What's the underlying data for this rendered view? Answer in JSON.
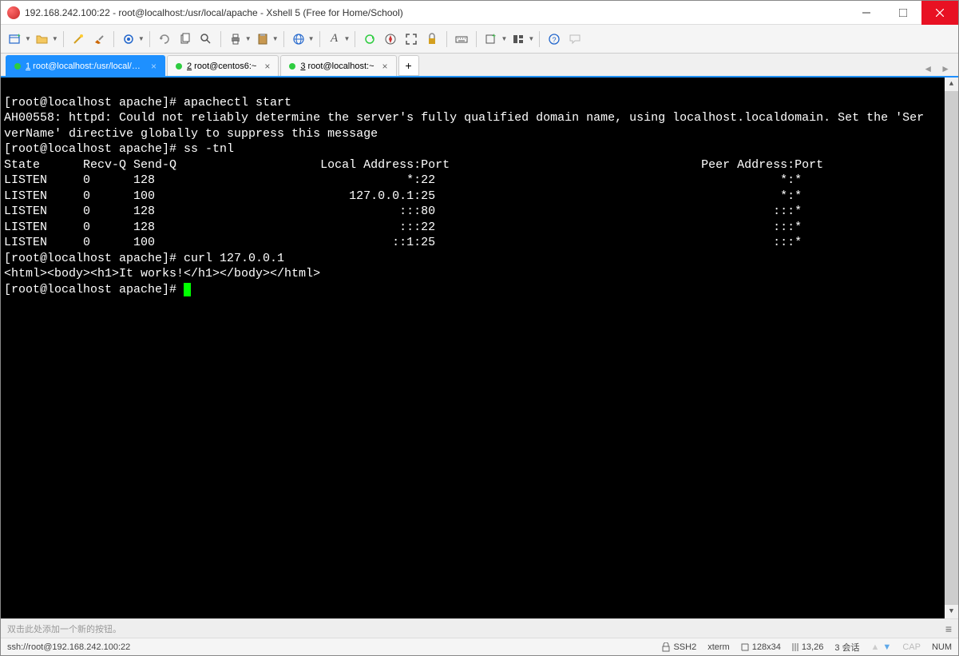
{
  "window": {
    "title": "192.168.242.100:22 - root@localhost:/usr/local/apache - Xshell 5 (Free for Home/School)"
  },
  "toolbar": {
    "icons": [
      "new-window",
      "open",
      "",
      "wand",
      "brush",
      "",
      "gear",
      "",
      "reconnect",
      "copy",
      "find",
      "",
      "printer",
      "clipboard",
      "",
      "globe",
      "",
      "font",
      "",
      "refresh",
      "compass",
      "fullscreen",
      "lock",
      "",
      "keyboard",
      "",
      "pane-add",
      "pane-layout",
      "",
      "help",
      "chat"
    ]
  },
  "tabs": [
    {
      "num": "1",
      "label": " root@localhost:/usr/local/a...",
      "active": true
    },
    {
      "num": "2",
      "label": " root@centos6:~",
      "active": false
    },
    {
      "num": "3",
      "label": " root@localhost:~",
      "active": false
    }
  ],
  "terminal": {
    "lines": [
      "[root@localhost apache]# apachectl start",
      "AH00558: httpd: Could not reliably determine the server's fully qualified domain name, using localhost.localdomain. Set the 'Ser",
      "verName' directive globally to suppress this message",
      "[root@localhost apache]# ss -tnl",
      "State      Recv-Q Send-Q                    Local Address:Port                                   Peer Address:Port",
      "LISTEN     0      128                                   *:22                                                *:*",
      "LISTEN     0      100                           127.0.0.1:25                                                *:*",
      "LISTEN     0      128                                  :::80                                               :::*",
      "LISTEN     0      128                                  :::22                                               :::*",
      "LISTEN     0      100                                 ::1:25                                               :::*",
      "[root@localhost apache]# curl 127.0.0.1",
      "<html><body><h1>It works!</h1></body></html>",
      "[root@localhost apache]# "
    ]
  },
  "custombar": {
    "text": "双击此处添加一个新的按钮。"
  },
  "statusbar": {
    "connection": "ssh://root@192.168.242.100:22",
    "ssh": "SSH2",
    "term": "xterm",
    "size": "128x34",
    "pos": "13,26",
    "sessions": "3 会话",
    "cap": "CAP",
    "num": "NUM"
  }
}
